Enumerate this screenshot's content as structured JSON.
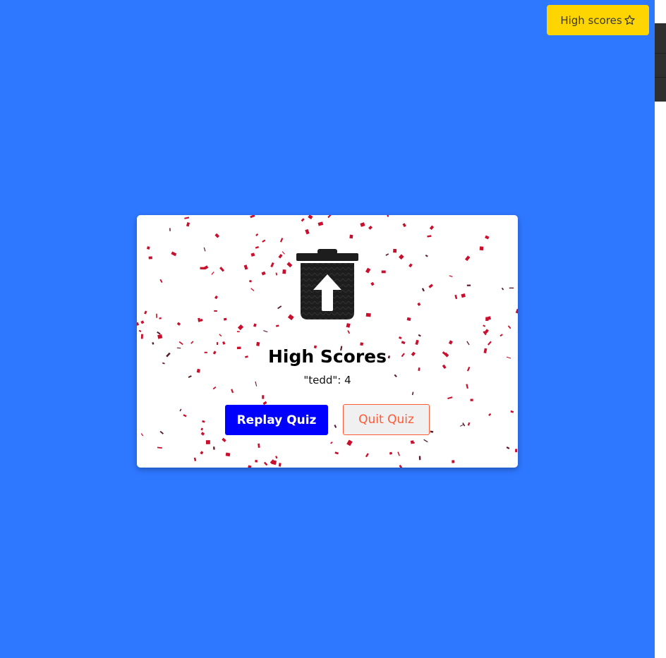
{
  "header": {
    "high_scores_button_label": "High scores",
    "high_scores_icon": "star-outline-icon"
  },
  "card": {
    "icon": "trash-restore-icon",
    "title": "High Scores",
    "score_entry": "\"tedd\": 4",
    "replay_button_label": "Replay Quiz",
    "quit_button_label": "Quit Quiz"
  },
  "colors": {
    "background": "#2e77ff",
    "high_scores_button": "#ffd500",
    "replay_button": "#0000ff",
    "quit_button_text": "#ff5a36",
    "confetti": "#c8102e"
  }
}
